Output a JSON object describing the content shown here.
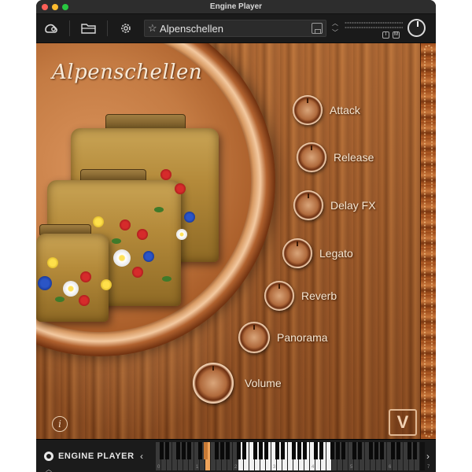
{
  "window": {
    "title": "Engine Player"
  },
  "toolbar": {
    "preset_name": "Alpenschellen",
    "star_glyph": "☆",
    "up_arrow": "︿",
    "down_arrow": "﹀",
    "io_left": "I",
    "io_right": "M"
  },
  "instrument": {
    "title": "Alpenschellen",
    "info_glyph": "i",
    "logo_glyph": "V"
  },
  "controls": [
    {
      "label": "Attack"
    },
    {
      "label": "Release"
    },
    {
      "label": "Delay FX"
    },
    {
      "label": "Legato"
    },
    {
      "label": "Reverb"
    },
    {
      "label": "Panorama"
    },
    {
      "label": "Volume"
    }
  ],
  "footer": {
    "brand": "ENGINE PLAYER",
    "octave_left": "‹",
    "octave_right": "›",
    "up_caret": "︿",
    "octave_labels": [
      "0",
      "1",
      "2",
      "3",
      "4",
      "5",
      "6",
      "7"
    ]
  },
  "colors": {
    "accent_key": "#f0a45a",
    "label_text": "#f5e6d2"
  }
}
